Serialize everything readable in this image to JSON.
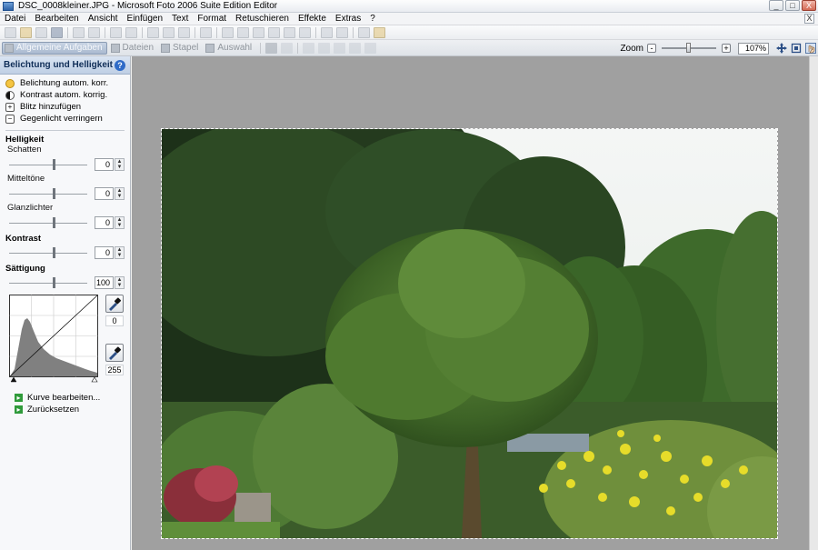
{
  "window": {
    "title": "DSC_0008kleiner.JPG - Microsoft Foto 2006 Suite Edition Editor",
    "controls": [
      "_",
      "□",
      "X"
    ]
  },
  "menubar": {
    "items": [
      "Datei",
      "Bearbeiten",
      "Ansicht",
      "Einfügen",
      "Text",
      "Format",
      "Retuschieren",
      "Effekte",
      "Extras",
      "?"
    ],
    "mdi_close": "X"
  },
  "tabs": {
    "items": [
      "Allgemeine Aufgaben",
      "Dateien",
      "Stapel",
      "Auswahl"
    ]
  },
  "zoom": {
    "label": "Zoom",
    "minus": "-",
    "plus": "+",
    "value": "107%",
    "slider_level": 0.45
  },
  "panel": {
    "title": "Belichtung und Helligkeit",
    "help": "?",
    "quick_actions": [
      "Belichtung autom. korr.",
      "Kontrast autom. korrig.",
      "Blitz hinzufügen",
      "Gegenlicht verringern"
    ],
    "quick_icon_glyphs": [
      "",
      "",
      "+",
      "−"
    ],
    "sections": {
      "helligkeit": "Helligkeit",
      "kontrast": "Kontrast",
      "saettigung": "Sättigung"
    },
    "sliders": {
      "schatten": {
        "label": "Schatten",
        "value": "0"
      },
      "mitteltoene": {
        "label": "Mitteltöne",
        "value": "0"
      },
      "glanzlichter": {
        "label": "Glanzlichter",
        "value": "0"
      },
      "kontrast": {
        "value": "0"
      },
      "saettigung": {
        "value": "100"
      }
    },
    "levels": {
      "black": "0",
      "white": "255"
    },
    "links": [
      "Kurve bearbeiten...",
      "Zurücksetzen"
    ]
  },
  "colors": {
    "panel_header": "#bfcfe5",
    "canvas_bg": "#a0a0a0",
    "link_arrow": "#2f9a3a"
  }
}
